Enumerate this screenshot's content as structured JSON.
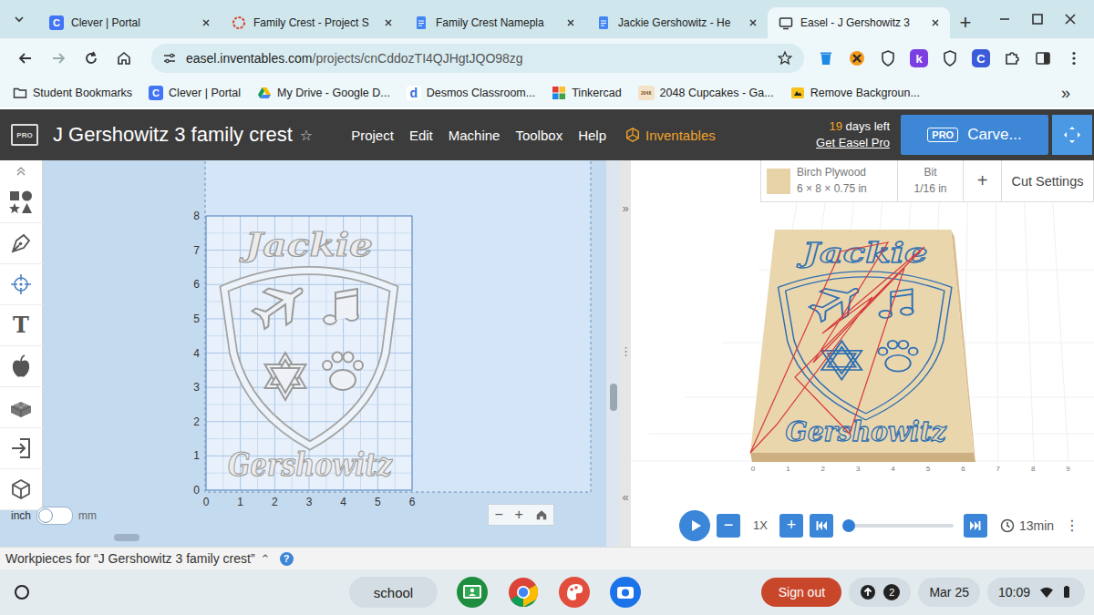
{
  "browser": {
    "tabs": [
      {
        "label": "Clever | Portal",
        "kind": "clever",
        "logo": "C",
        "selected": false
      },
      {
        "label": "Family Crest - Project S",
        "kind": "crest",
        "selected": false
      },
      {
        "label": "Family Crest Namepla",
        "kind": "docs",
        "selected": false
      },
      {
        "label": "Jackie Gershowitz - He",
        "kind": "docs",
        "selected": false
      },
      {
        "label": "Easel - J Gershowitz 3",
        "kind": "easel",
        "selected": true
      }
    ],
    "new_tab": "+",
    "url_host": "easel.inventables.com",
    "url_path": "/projects/cnCddozTI4QJHgtJQO98zg",
    "extensions": [
      {
        "kind": "trash"
      },
      {
        "kind": "orange"
      },
      {
        "kind": "shield"
      },
      {
        "kind": "letter",
        "text": "k",
        "color": "#7b3fe4"
      },
      {
        "kind": "shield"
      },
      {
        "kind": "letter",
        "text": "C",
        "color": "#3b5bdb"
      },
      {
        "kind": "puzzle"
      },
      {
        "kind": "sidebar"
      },
      {
        "kind": "more"
      }
    ],
    "bookmarks": [
      {
        "label": "Student Bookmarks",
        "kind": "folder"
      },
      {
        "label": "Clever | Portal",
        "kind": "clever",
        "logo": "C"
      },
      {
        "label": "My Drive - Google D...",
        "kind": "drive"
      },
      {
        "label": "Desmos Classroom...",
        "kind": "desmos",
        "logo": "d"
      },
      {
        "label": "Tinkercad",
        "kind": "tinkercad"
      },
      {
        "label": "2048 Cupcakes - Ga...",
        "kind": "cupcakes",
        "logo": "2048"
      },
      {
        "label": "Remove Backgroun...",
        "kind": "remove"
      }
    ],
    "bookmarks_more": "»"
  },
  "app": {
    "logo": "PRO",
    "title": "J Gershowitz 3 family crest",
    "star": "☆",
    "menu": [
      "Project",
      "Edit",
      "Machine",
      "Toolbox",
      "Help"
    ],
    "brand": "Inventables",
    "trial_days": "19",
    "trial_text": "days left",
    "trial_link": "Get Easel Pro",
    "carve_badge": "PRO",
    "carve": "Carve..."
  },
  "tools": [
    {
      "kind": "collapse"
    },
    {
      "kind": "shapes"
    },
    {
      "kind": "pen"
    },
    {
      "kind": "target"
    },
    {
      "kind": "text",
      "text": "T"
    },
    {
      "kind": "apple"
    },
    {
      "kind": "blocks"
    },
    {
      "kind": "import"
    },
    {
      "kind": "cube"
    }
  ],
  "canvas": {
    "x_ticks": [
      "0",
      "1",
      "2",
      "3",
      "4",
      "5",
      "6"
    ],
    "y_ticks": [
      "0",
      "1",
      "2",
      "3",
      "4",
      "5",
      "6",
      "7",
      "8"
    ],
    "units": [
      {
        "label": "inch",
        "selected": true
      },
      {
        "label": "mm",
        "selected": false
      }
    ],
    "zoom_out": "−",
    "zoom_in": "+"
  },
  "panel_handles": {
    "expand": "»",
    "grip": "⋮",
    "collapse": "«"
  },
  "design": {
    "top_text": "Jackie",
    "bottom_text": "Gershowitz"
  },
  "material": {
    "name": "Birch Plywood",
    "size": "6 × 8 × 0.75 in",
    "bit_label": "Bit",
    "bit": "1/16 in",
    "add": "+",
    "cut_settings": "Cut Settings"
  },
  "preview": {
    "ticks": [
      "0",
      "1",
      "2",
      "3",
      "4",
      "5",
      "6",
      "7",
      "8",
      "9"
    ],
    "speed": "1X",
    "minus": "−",
    "plus": "+",
    "progress": 0,
    "time": "13min",
    "more": "⋮"
  },
  "footer": {
    "label": "Workpieces for “J Gershowitz 3 family crest”",
    "caret": "⌃",
    "help": "?"
  },
  "shelf": {
    "desk": "school",
    "apps": [
      {
        "kind": "classroom"
      },
      {
        "kind": "chrome"
      },
      {
        "kind": "canvas"
      },
      {
        "kind": "camera"
      }
    ],
    "sign_out": "Sign out",
    "notifications": "2",
    "date": "Mar 25",
    "time": "10:09"
  }
}
